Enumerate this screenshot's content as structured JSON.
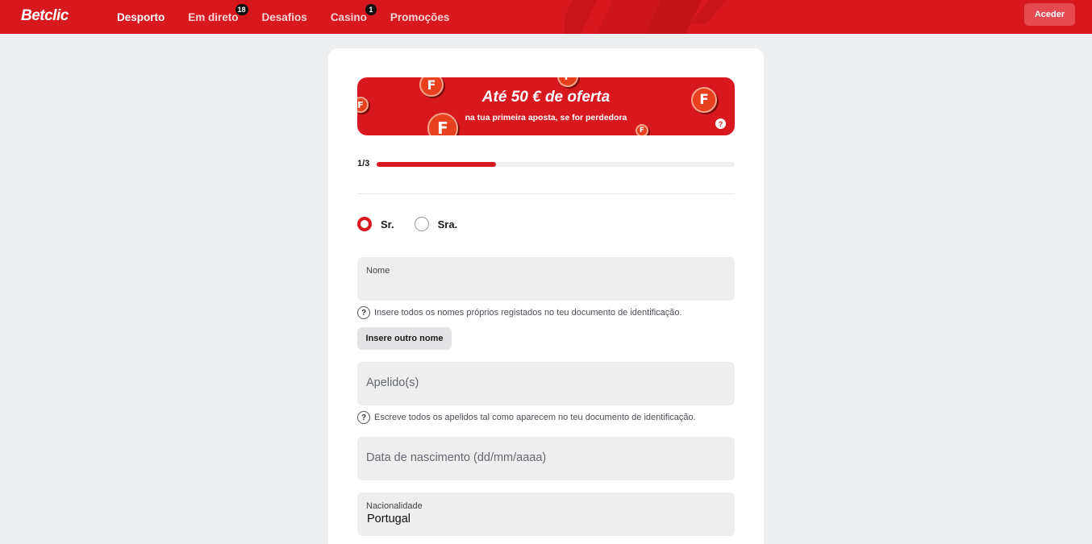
{
  "header": {
    "logo": "Betclic",
    "nav": [
      {
        "label": "Desporto",
        "badge": null
      },
      {
        "label": "Em direto",
        "badge": "18"
      },
      {
        "label": "Desafios",
        "badge": null
      },
      {
        "label": "Casino",
        "badge": "1"
      },
      {
        "label": "Promoções",
        "badge": null
      }
    ],
    "login_label": "Aceder",
    "brand_color": "#d7191f"
  },
  "banner": {
    "title": "Até 50 € de oferta",
    "subtitle": "na tua primeira aposta, se for perdedora",
    "coin_letter": "F",
    "help_glyph": "?"
  },
  "progress": {
    "step_label": "1/3",
    "fraction": 0.333
  },
  "form": {
    "gender_options": [
      {
        "label": "Sr.",
        "checked": true
      },
      {
        "label": "Sra.",
        "checked": false
      }
    ],
    "name": {
      "label": "Nome",
      "help": "Insere todos os nomes próprios registados no teu documento de identificação.",
      "add_button": "Insere outro nome"
    },
    "surname": {
      "placeholder": "Apelido(s)",
      "help": "Escreve todos os apelidos tal como aparecem no teu documento de identificação."
    },
    "birthdate": {
      "placeholder": "Data de nascimento (dd/mm/aaaa)"
    },
    "nationality": {
      "label": "Nacionalidade",
      "value": "Portugal"
    },
    "help_glyph": "?"
  }
}
